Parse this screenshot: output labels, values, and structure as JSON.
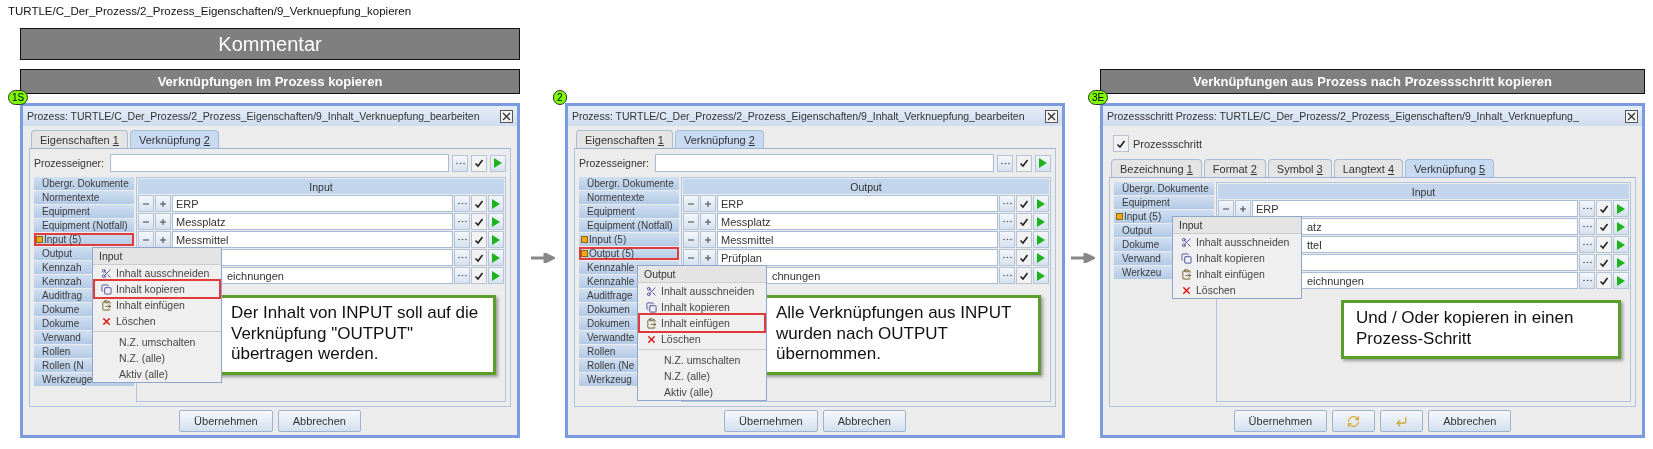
{
  "path": "TURTLE/C_Der_Prozess/2_Prozess_Eigenschaften/9_Verknuepfung_kopieren",
  "comment_bar": {
    "label": "Kommentar"
  },
  "panels": [
    {
      "heading": "Verknüpfungen im Prozess kopieren",
      "badge": "1S",
      "dialog": {
        "title": "Prozess: TURTLE/C_Der_Prozess/2_Prozess_Eigenschaften/9_Inhalt_Verknuepfung_bearbeiten",
        "tabs": [
          {
            "label": "Eigenschaften",
            "key": "1",
            "selected": false
          },
          {
            "label": "Verknüpfung",
            "key": "2",
            "selected": true
          }
        ],
        "owner_field": {
          "label": "Prozesseigner:",
          "checked": true
        },
        "categories": [
          {
            "label": "Übergr. Dokumente",
            "modified": false,
            "highlighted": false
          },
          {
            "label": "Normentexte",
            "modified": false,
            "highlighted": false
          },
          {
            "label": "Equipment",
            "modified": false,
            "highlighted": false
          },
          {
            "label": "Equipment (Notfall)",
            "modified": false,
            "highlighted": false
          },
          {
            "label": "Input (5)",
            "modified": true,
            "highlighted": true
          },
          {
            "label": "Output",
            "modified": false,
            "highlighted": false
          },
          {
            "label": "Kennzah",
            "modified": false,
            "highlighted": false
          },
          {
            "label": "Kennzah",
            "modified": false,
            "highlighted": false
          },
          {
            "label": "Auditfrag",
            "modified": false,
            "highlighted": false
          },
          {
            "label": "Dokume",
            "modified": false,
            "highlighted": false
          },
          {
            "label": "Dokume",
            "modified": false,
            "highlighted": false
          },
          {
            "label": "Verwand",
            "modified": false,
            "highlighted": false
          },
          {
            "label": "Rollen",
            "modified": false,
            "highlighted": false
          },
          {
            "label": "Rollen (N",
            "modified": false,
            "highlighted": false
          },
          {
            "label": "Werkzeuge",
            "modified": false,
            "highlighted": false
          }
        ],
        "table": {
          "header": "Input",
          "rows": [
            {
              "kind": "full",
              "text": "ERP",
              "checked": true
            },
            {
              "kind": "full",
              "text": "Messplatz",
              "checked": true
            },
            {
              "kind": "full",
              "text": "Messmittel",
              "checked": true
            },
            {
              "kind": "partial",
              "checked": true
            },
            {
              "kind": "partial",
              "text": "eichnungen",
              "checked": true
            }
          ]
        },
        "context_menu": {
          "title": "Input",
          "groups": [
            {
              "items": [
                {
                  "label": "Inhalt ausschneiden",
                  "kind": "cut",
                  "highlighted": false
                },
                {
                  "label": "Inhalt kopieren",
                  "kind": "copy",
                  "highlighted": true
                },
                {
                  "label": "Inhalt einfügen",
                  "kind": "paste",
                  "highlighted": false
                },
                {
                  "label": "Löschen",
                  "kind": "delete",
                  "highlighted": false
                }
              ]
            },
            {
              "items": [
                {
                  "label": "N.Z. umschalten",
                  "kind": "plain",
                  "highlighted": false
                },
                {
                  "label": "N.Z. (alle)",
                  "kind": "plain",
                  "highlighted": false
                },
                {
                  "label": "Aktiv (alle)",
                  "kind": "plain",
                  "highlighted": false
                }
              ]
            }
          ]
        },
        "callout": "Der Inhalt von INPUT soll auf die Verknüpfung \"OUTPUT\" übertragen werden.",
        "buttons": [
          {
            "kind": "text",
            "label": "Übernehmen"
          },
          {
            "kind": "text",
            "label": "Abbrechen"
          }
        ]
      }
    },
    {
      "badge": "2",
      "dialog": {
        "title": "Prozess: TURTLE/C_Der_Prozess/2_Prozess_Eigenschaften/9_Inhalt_Verknuepfung_bearbeiten",
        "tabs": [
          {
            "label": "Eigenschaften",
            "key": "1",
            "selected": false
          },
          {
            "label": "Verknüpfung",
            "key": "2",
            "selected": true
          }
        ],
        "owner_field": {
          "label": "Prozesseigner:",
          "checked": true
        },
        "categories": [
          {
            "label": "Übergr. Dokumente",
            "modified": false,
            "highlighted": false
          },
          {
            "label": "Normentexte",
            "modified": false,
            "highlighted": false
          },
          {
            "label": "Equipment",
            "modified": false,
            "highlighted": false
          },
          {
            "label": "Equipment (Notfall)",
            "modified": false,
            "highlighted": false
          },
          {
            "label": "Input (5)",
            "modified": true,
            "highlighted": false
          },
          {
            "label": "Output (5)",
            "modified": true,
            "highlighted": true
          },
          {
            "label": "Kennzahle",
            "modified": false,
            "highlighted": false
          },
          {
            "label": "Kennzahle",
            "modified": false,
            "highlighted": false
          },
          {
            "label": "Auditfrage",
            "modified": false,
            "highlighted": false
          },
          {
            "label": "Dokumen",
            "modified": false,
            "highlighted": false
          },
          {
            "label": "Dokumen",
            "modified": false,
            "highlighted": false
          },
          {
            "label": "Verwandte",
            "modified": false,
            "highlighted": false
          },
          {
            "label": "Rollen",
            "modified": false,
            "highlighted": false
          },
          {
            "label": "Rollen (Ne",
            "modified": false,
            "highlighted": false
          },
          {
            "label": "Werkzeug",
            "modified": false,
            "highlighted": false
          }
        ],
        "table": {
          "header": "Output",
          "rows": [
            {
              "kind": "full",
              "text": "ERP",
              "checked": true
            },
            {
              "kind": "full",
              "text": "Messplatz",
              "checked": true
            },
            {
              "kind": "full",
              "text": "Messmittel",
              "checked": true
            },
            {
              "kind": "full",
              "text": "Prüfplan",
              "checked": true
            },
            {
              "kind": "partial",
              "text": "chnungen",
              "checked": true
            }
          ]
        },
        "context_menu": {
          "title": "Output",
          "groups": [
            {
              "items": [
                {
                  "label": "Inhalt ausschneiden",
                  "kind": "cut",
                  "highlighted": false
                },
                {
                  "label": "Inhalt kopieren",
                  "kind": "copy",
                  "highlighted": false
                },
                {
                  "label": "Inhalt einfügen",
                  "kind": "paste",
                  "highlighted": true
                },
                {
                  "label": "Löschen",
                  "kind": "delete",
                  "highlighted": false
                }
              ]
            },
            {
              "items": [
                {
                  "label": "N.Z. umschalten",
                  "kind": "plain",
                  "highlighted": false
                },
                {
                  "label": "N.Z. (alle)",
                  "kind": "plain",
                  "highlighted": false
                },
                {
                  "label": "Aktiv (alle)",
                  "kind": "plain",
                  "highlighted": false
                }
              ]
            }
          ]
        },
        "callout": "Alle Verknüpfungen aus INPUT wurden nach OUTPUT übernommen.",
        "buttons": [
          {
            "kind": "text",
            "label": "Übernehmen"
          },
          {
            "kind": "text",
            "label": "Abbrechen"
          }
        ]
      }
    },
    {
      "heading": "Verknüpfungen aus Prozess nach Prozessschritt kopieren",
      "badge": "3E",
      "dialog": {
        "title": "Prozessschritt Prozess: TURTLE/C_Der_Prozess/2_Prozess_Eigenschaften/9_Inhalt_Verknuepfung_",
        "step_checkbox": {
          "label": "Prozessschritt",
          "checked": true
        },
        "tabs": [
          {
            "label": "Bezeichnung",
            "key": "1",
            "selected": false
          },
          {
            "label": "Format",
            "key": "2",
            "selected": false
          },
          {
            "label": "Symbol",
            "key": "3",
            "selected": false
          },
          {
            "label": "Langtext",
            "key": "4",
            "selected": false
          },
          {
            "label": "Verknüpfung",
            "key": "5",
            "selected": true
          }
        ],
        "categories": [
          {
            "label": "Übergr. Dokumente",
            "modified": false,
            "highlighted": false
          },
          {
            "label": "Equipment",
            "modified": false,
            "highlighted": false
          },
          {
            "label": "Input (5)",
            "modified": true,
            "highlighted": false
          },
          {
            "label": "Output",
            "modified": false,
            "highlighted": false
          },
          {
            "label": "Dokume",
            "modified": false,
            "highlighted": false
          },
          {
            "label": "Verwand",
            "modified": false,
            "highlighted": false
          },
          {
            "label": "Werkzeu",
            "modified": false,
            "highlighted": false
          }
        ],
        "table": {
          "header": "Input",
          "rows": [
            {
              "kind": "full",
              "text": "ERP",
              "checked": true
            },
            {
              "kind": "partial",
              "text": "atz",
              "checked": true
            },
            {
              "kind": "partial",
              "text": "ttel",
              "checked": true
            },
            {
              "kind": "partial",
              "checked": true
            },
            {
              "kind": "partial",
              "text": "eichnungen",
              "checked": true
            }
          ]
        },
        "context_menu": {
          "title": "Input",
          "groups": [
            {
              "items": [
                {
                  "label": "Inhalt ausschneiden",
                  "kind": "cut",
                  "highlighted": false
                },
                {
                  "label": "Inhalt kopieren",
                  "kind": "copy",
                  "highlighted": false
                },
                {
                  "label": "Inhalt einfügen",
                  "kind": "paste",
                  "highlighted": false
                },
                {
                  "label": "Löschen",
                  "kind": "delete",
                  "highlighted": false
                }
              ]
            }
          ]
        },
        "callout": "Und / Oder kopieren in einen Prozess-Schritt",
        "buttons": [
          {
            "kind": "text",
            "label": "Übernehmen"
          },
          {
            "kind": "sync"
          },
          {
            "kind": "back"
          },
          {
            "kind": "text",
            "label": "Abbrechen"
          }
        ]
      }
    }
  ]
}
